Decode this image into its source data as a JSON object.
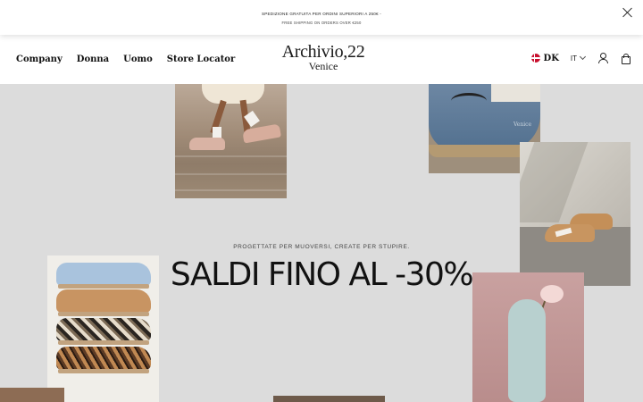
{
  "announcement": {
    "line1": "SPEDIZIONE GRATUITA PER ORDINI SUPERIORI A 250€ -",
    "line2": "FREE SHIPPING ON ORDERS OVER €250",
    "close_icon": "close-icon"
  },
  "header": {
    "nav": [
      "Company",
      "Donna",
      "Uomo",
      "Store Locator"
    ],
    "logo": {
      "brand": "Archivio,22",
      "city": "Venice"
    },
    "country": {
      "flag_icon": "denmark-flag-icon",
      "code": "DK"
    },
    "language": "IT",
    "icons": [
      "account-icon",
      "cart-icon"
    ]
  },
  "hero": {
    "tagline": "PROGETTATE PER MUOVERSI, CREATE PER STUPIRE.",
    "headline": "SALDI FINO AL -30%",
    "photos": [
      "legs-on-steps-photo",
      "blue-sneaker-photo",
      "tan-sneakers-photo",
      "stacked-sneakers-photo",
      "mint-sneaker-flower-photo"
    ],
    "product_text": "Venice"
  }
}
